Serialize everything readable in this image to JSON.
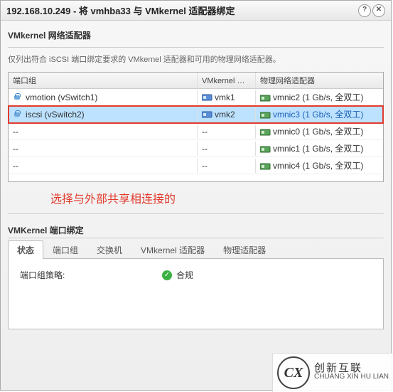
{
  "title": "192.168.10.249 - 将 vmhba33 与 VMkernel 适配器绑定",
  "section1": {
    "heading": "VMkernel 网络适配器",
    "sub": "仅列出符合 iSCSI 端口绑定要求的 VMkernel 适配器和可用的物理网络适配器。"
  },
  "grid": {
    "headers": {
      "port": "端口组",
      "vmk": "VMkernel 适...",
      "phys": "物理网络适配器"
    },
    "rows": [
      {
        "port": "vmotion (vSwitch1)",
        "vmk": "vmk1",
        "phys_name": "vmnic2",
        "phys_detail": "(1 Gb/s, 全双工)",
        "selected": false,
        "highlighted": false
      },
      {
        "port": "iscsi (vSwitch2)",
        "vmk": "vmk2",
        "phys_name": "vmnic3",
        "phys_detail": "(1 Gb/s, 全双工)",
        "selected": true,
        "highlighted": true
      },
      {
        "port": "--",
        "vmk": "--",
        "phys_name": "vmnic0",
        "phys_detail": "(1 Gb/s, 全双工)",
        "selected": false,
        "highlighted": false
      },
      {
        "port": "--",
        "vmk": "--",
        "phys_name": "vmnic1",
        "phys_detail": "(1 Gb/s, 全双工)",
        "selected": false,
        "highlighted": false
      },
      {
        "port": "--",
        "vmk": "--",
        "phys_name": "vmnic4",
        "phys_detail": "(1 Gb/s, 全双工)",
        "selected": false,
        "highlighted": false
      }
    ]
  },
  "annotation": "选择与外部共享相连接的",
  "section2": {
    "heading": "VMKernel 端口绑定"
  },
  "tabs": {
    "items": [
      {
        "id": "status",
        "label": "状态"
      },
      {
        "id": "portgrp",
        "label": "端口组"
      },
      {
        "id": "switch",
        "label": "交换机"
      },
      {
        "id": "vmknic",
        "label": "VMkernel 适配器"
      },
      {
        "id": "physnic",
        "label": "物理适配器"
      }
    ],
    "active": "status"
  },
  "status_panel": {
    "policy_label": "端口组策略:",
    "policy_value": "合规"
  },
  "watermark": {
    "logo": "CX",
    "line1": "创新互联",
    "line2": "CHUANG XIN HU LIAN"
  }
}
